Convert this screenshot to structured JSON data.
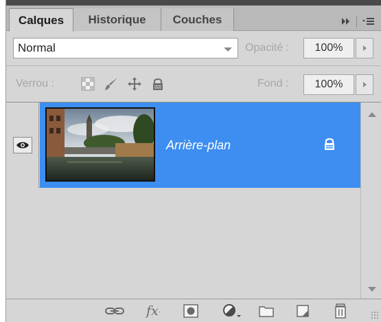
{
  "tabs": [
    {
      "label": "Calques",
      "active": true
    },
    {
      "label": "Historique",
      "active": false
    },
    {
      "label": "Couches",
      "active": false
    }
  ],
  "tab_menu": {
    "expand_glyph": "▸▸",
    "menu_glyph": "▾≡"
  },
  "blend": {
    "mode": "Normal"
  },
  "opacity": {
    "label": "Opacité :",
    "value": "100%"
  },
  "lock": {
    "label": "Verrou :"
  },
  "fill": {
    "label": "Fond :",
    "value": "100%"
  },
  "layers": [
    {
      "name": "Arrière-plan",
      "visible": true,
      "locked": true,
      "selected": true
    }
  ],
  "colors": {
    "selection": "#3d8ef0",
    "panel": "#d6d6d6",
    "tabbar": "#b9b9b9"
  },
  "icons": {
    "lock_row": [
      "lock-transparent-pixels-icon",
      "lock-image-pixels-icon",
      "lock-position-icon",
      "lock-all-icon"
    ],
    "bottom": [
      "link-layers-icon",
      "fx-icon",
      "layer-mask-icon",
      "adjustment-layer-icon",
      "group-folder-icon",
      "new-layer-icon",
      "trash-icon"
    ]
  }
}
